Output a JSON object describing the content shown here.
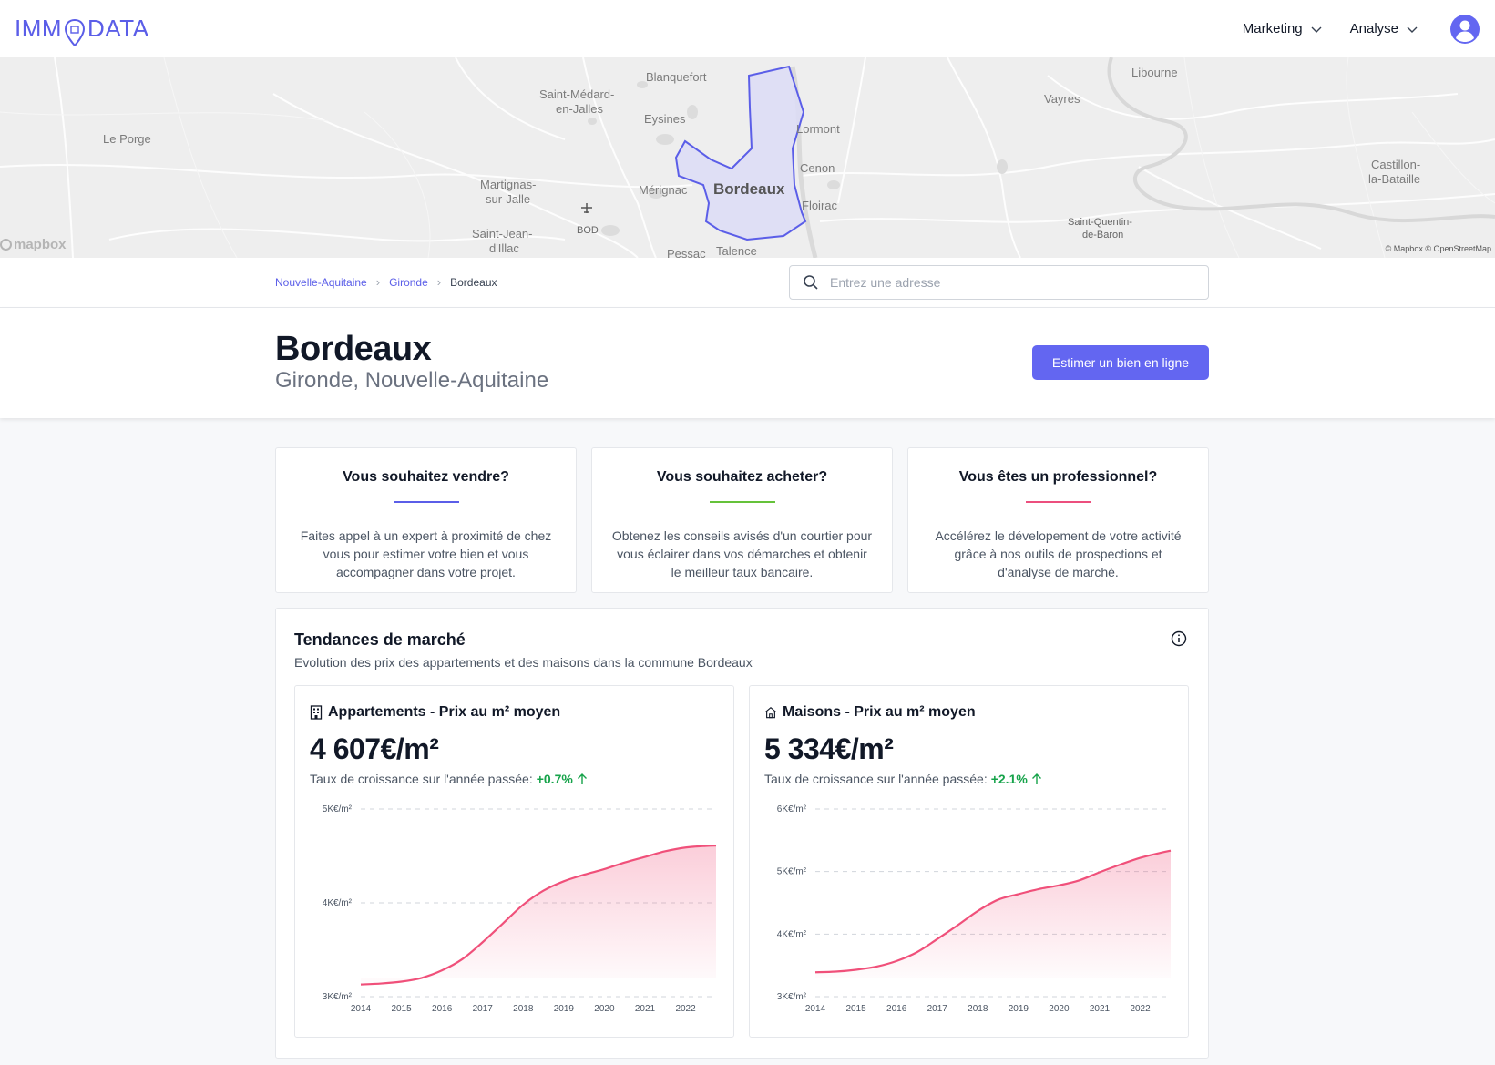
{
  "header": {
    "logo_left": "IMM",
    "logo_right": "DATA",
    "nav": [
      {
        "label": "Marketing"
      },
      {
        "label": "Analyse"
      }
    ]
  },
  "map": {
    "labels": {
      "blanquefort": "Blanquefort",
      "libourne": "Libourne",
      "saint_medard_1": "Saint-Médard-",
      "saint_medard_2": "en-Jalles",
      "vayres": "Vayres",
      "eysines": "Eysines",
      "lormont": "Lormont",
      "le_porge": "Le Porge",
      "cenon": "Cenon",
      "castillon_1": "Castillon-",
      "castillon_2": "la-Bataille",
      "martignas_1": "Martignas-",
      "martignas_2": "sur-Jalle",
      "merignac": "Mérignac",
      "bordeaux": "Bordeaux",
      "floirac": "Floirac",
      "bod": "BOD",
      "saint_quentin_1": "Saint-Quentin-",
      "saint_quentin_2": "de-Baron",
      "saint_jean_1": "Saint-Jean-",
      "saint_jean_2": "d'Illac",
      "pessac": "Pessac",
      "talence": "Talence"
    },
    "mapbox_logo": "mapbox",
    "attribution": "© Mapbox © OpenStreetMap"
  },
  "breadcrumb": {
    "items": [
      "Nouvelle-Aquitaine",
      "Gironde"
    ],
    "current": "Bordeaux"
  },
  "search": {
    "placeholder": "Entrez une adresse"
  },
  "title": {
    "city": "Bordeaux",
    "region": "Gironde, Nouvelle-Aquitaine",
    "cta_label": "Estimer un bien en ligne"
  },
  "cards": [
    {
      "title": "Vous souhaitez vendre?",
      "text": "Faites appel à un expert à proximité de chez vous pour estimer votre bien et vous accompagner dans votre projet.",
      "accent": "#5b5ee8"
    },
    {
      "title": "Vous souhaitez acheter?",
      "text": "Obtenez les conseils avisés d'un courtier pour vous éclairer dans vos démarches et obtenir le meilleur taux bancaire.",
      "accent": "#65c23a"
    },
    {
      "title": "Vous êtes un professionnel?",
      "text": "Accélérez le dévelopement de votre activité grâce à nos outils de prospections et d'analyse de marché.",
      "accent": "#ec4f7e"
    }
  ],
  "market": {
    "title": "Tendances de marché",
    "description": "Evolution des prix des appartements et des maisons dans la commune Bordeaux"
  },
  "colors": {
    "brand": "#6366f1",
    "line": "#f0507a",
    "growth": "#16a34a"
  },
  "charts": {
    "appartements": {
      "title": "Appartements - Prix au m² moyen",
      "price": "4 607€/m²",
      "growth_label": "Taux de croissance sur l'année passée:",
      "growth_value": "+0.7%"
    },
    "maisons": {
      "title": "Maisons - Prix au m² moyen",
      "price": "5 334€/m²",
      "growth_label": "Taux de croissance sur l'année passée:",
      "growth_value": "+2.1%"
    }
  },
  "chart_data": [
    {
      "type": "area",
      "title": "Appartements - Prix au m² moyen",
      "x": [
        2014,
        2014.5,
        2015,
        2015.5,
        2016,
        2016.5,
        2017,
        2017.5,
        2018,
        2018.5,
        2019,
        2019.5,
        2020,
        2020.5,
        2021,
        2021.5,
        2022,
        2022.5,
        2022.75
      ],
      "y": [
        3130,
        3140,
        3160,
        3200,
        3280,
        3400,
        3580,
        3780,
        3980,
        4130,
        4230,
        4300,
        4360,
        4430,
        4490,
        4550,
        4590,
        4607,
        4610
      ],
      "xticks": [
        "2014",
        "2015",
        "2016",
        "2017",
        "2018",
        "2019",
        "2020",
        "2021",
        "2022"
      ],
      "yticks": [
        "3K€/m²",
        "4K€/m²",
        "5K€/m²"
      ],
      "ylim": [
        3000,
        5000
      ],
      "xlim": [
        2014,
        2022.75
      ],
      "grid": true
    },
    {
      "type": "area",
      "title": "Maisons - Prix au m² moyen",
      "x": [
        2014,
        2014.5,
        2015,
        2015.5,
        2016,
        2016.5,
        2017,
        2017.5,
        2018,
        2018.5,
        2019,
        2019.5,
        2020,
        2020.5,
        2021,
        2021.5,
        2022,
        2022.5,
        2022.75
      ],
      "y": [
        3390,
        3400,
        3430,
        3480,
        3570,
        3710,
        3920,
        4140,
        4370,
        4550,
        4640,
        4720,
        4780,
        4860,
        4990,
        5110,
        5220,
        5300,
        5334
      ],
      "xticks": [
        "2014",
        "2015",
        "2016",
        "2017",
        "2018",
        "2019",
        "2020",
        "2021",
        "2022"
      ],
      "yticks": [
        "3K€/m²",
        "4K€/m²",
        "5K€/m²",
        "6K€/m²"
      ],
      "ylim": [
        3000,
        6000
      ],
      "xlim": [
        2014,
        2022.75
      ],
      "grid": true
    }
  ]
}
